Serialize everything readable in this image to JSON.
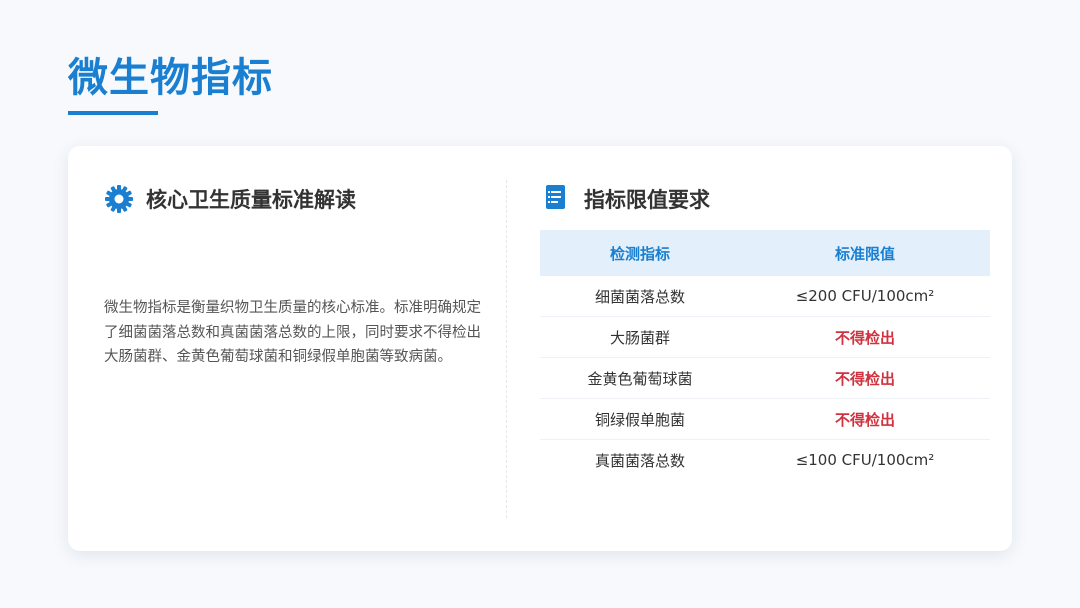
{
  "title": "微生物指标",
  "colors": {
    "accent": "#1a7fd0",
    "fail": "#d0323f",
    "table_header_bg": "#e3f0fb"
  },
  "left": {
    "icon": "gear-icon",
    "heading": "核心卫生质量标准解读",
    "body": "微生物指标是衡量织物卫生质量的核心标准。标准明确规定了细菌菌落总数和真菌菌落总数的上限，同时要求不得检出大肠菌群、金黄色葡萄球菌和铜绿假单胞菌等致病菌。"
  },
  "right": {
    "icon": "list-document-icon",
    "heading": "指标限值要求",
    "table": {
      "headers": [
        "检测指标",
        "标准限值"
      ],
      "rows": [
        {
          "indicator": "细菌菌落总数",
          "limit": "≤200 CFU/100cm²",
          "status": "limit"
        },
        {
          "indicator": "大肠菌群",
          "limit": "不得检出",
          "status": "fail"
        },
        {
          "indicator": "金黄色葡萄球菌",
          "limit": "不得检出",
          "status": "fail"
        },
        {
          "indicator": "铜绿假单胞菌",
          "limit": "不得检出",
          "status": "fail"
        },
        {
          "indicator": "真菌菌落总数",
          "limit": "≤100 CFU/100cm²",
          "status": "limit"
        }
      ]
    }
  }
}
